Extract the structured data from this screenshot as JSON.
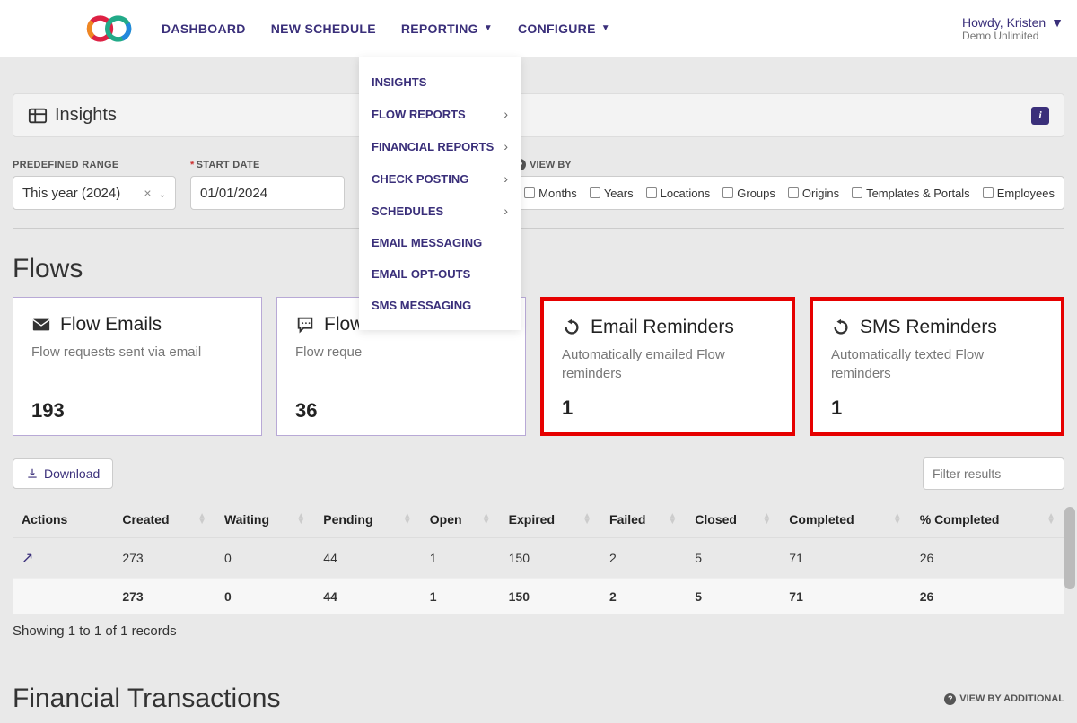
{
  "nav": {
    "items": [
      "DASHBOARD",
      "NEW SCHEDULE",
      "REPORTING",
      "CONFIGURE"
    ]
  },
  "user": {
    "greeting": "Howdy, Kristen",
    "sub": "Demo Unlimited"
  },
  "dropdown": {
    "items": [
      {
        "label": "INSIGHTS",
        "arrow": false
      },
      {
        "label": "FLOW REPORTS",
        "arrow": true
      },
      {
        "label": "FINANCIAL REPORTS",
        "arrow": true
      },
      {
        "label": "CHECK POSTING",
        "arrow": true
      },
      {
        "label": "SCHEDULES",
        "arrow": true
      },
      {
        "label": "EMAIL MESSAGING",
        "arrow": false
      },
      {
        "label": "EMAIL OPT-OUTS",
        "arrow": false
      },
      {
        "label": "SMS MESSAGING",
        "arrow": false
      }
    ]
  },
  "page_title": "Insights",
  "filters": {
    "predefined_label": "PREDEFINED RANGE",
    "predefined_value": "This year (2024)",
    "start_label": "START DATE",
    "start_value": "01/01/2024",
    "viewby_label": "VIEW BY",
    "viewby_opts": [
      "Months",
      "Years",
      "Locations",
      "Groups",
      "Origins",
      "Templates & Portals",
      "Employees"
    ]
  },
  "flows": {
    "title": "Flows",
    "cards": [
      {
        "title": "Flow Emails",
        "desc": "Flow requests sent via email",
        "count": "193"
      },
      {
        "title": "Flow S",
        "desc": "Flow reque",
        "count": "36"
      },
      {
        "title": "Email Reminders",
        "desc": "Automatically emailed Flow reminders",
        "count": "1"
      },
      {
        "title": "SMS Reminders",
        "desc": "Automatically texted Flow reminders",
        "count": "1"
      }
    ]
  },
  "table": {
    "download": "Download",
    "filter_placeholder": "Filter results",
    "cols": [
      "Actions",
      "Created",
      "Waiting",
      "Pending",
      "Open",
      "Expired",
      "Failed",
      "Closed",
      "Completed",
      "% Completed"
    ],
    "row": [
      "",
      "273",
      "0",
      "44",
      "1",
      "150",
      "2",
      "5",
      "71",
      "26"
    ],
    "total": [
      "",
      "273",
      "0",
      "44",
      "1",
      "150",
      "2",
      "5",
      "71",
      "26"
    ],
    "records_note": "Showing 1 to 1 of 1 records"
  },
  "fin": {
    "title": "Financial Transactions",
    "viewby": "VIEW BY ADDITIONAL"
  }
}
